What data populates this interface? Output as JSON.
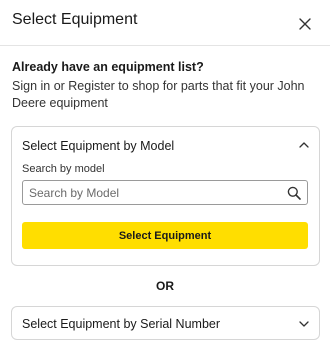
{
  "header": {
    "title": "Select Equipment",
    "close_icon": "close-icon"
  },
  "intro": {
    "heading": "Already have an equipment list?",
    "text": "Sign in or Register to shop for parts that fit your John Deere equipment"
  },
  "by_model": {
    "title": "Select Equipment by Model",
    "expanded": true,
    "chevron_icon": "chevron-up-icon",
    "search_label": "Search by model",
    "search_placeholder": "Search by Model",
    "search_value": "",
    "search_icon": "search-icon",
    "button_label": "Select Equipment",
    "button_color": "#ffde00"
  },
  "separator": "OR",
  "by_serial": {
    "title": "Select Equipment by Serial Number",
    "expanded": false,
    "chevron_icon": "chevron-down-icon"
  }
}
